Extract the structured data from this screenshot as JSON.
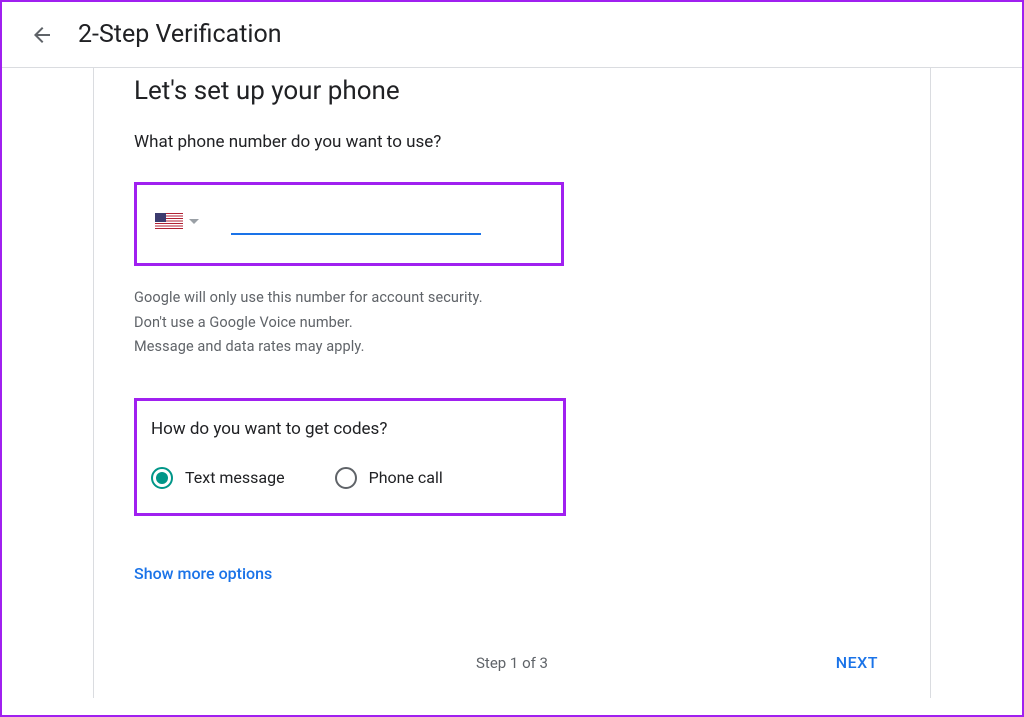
{
  "header": {
    "title": "2-Step Verification"
  },
  "setup": {
    "title": "Let's set up your phone",
    "question": "What phone number do you want to use?"
  },
  "phone": {
    "country": "US",
    "value": ""
  },
  "disclaimer": {
    "line1": "Google will only use this number for account security.",
    "line2": "Don't use a Google Voice number.",
    "line3": "Message and data rates may apply."
  },
  "codes": {
    "question": "How do you want to get codes?",
    "options": {
      "text": "Text message",
      "call": "Phone call"
    },
    "selected": "text"
  },
  "showMore": "Show more options",
  "footer": {
    "step": "Step 1 of 3",
    "next": "NEXT"
  }
}
